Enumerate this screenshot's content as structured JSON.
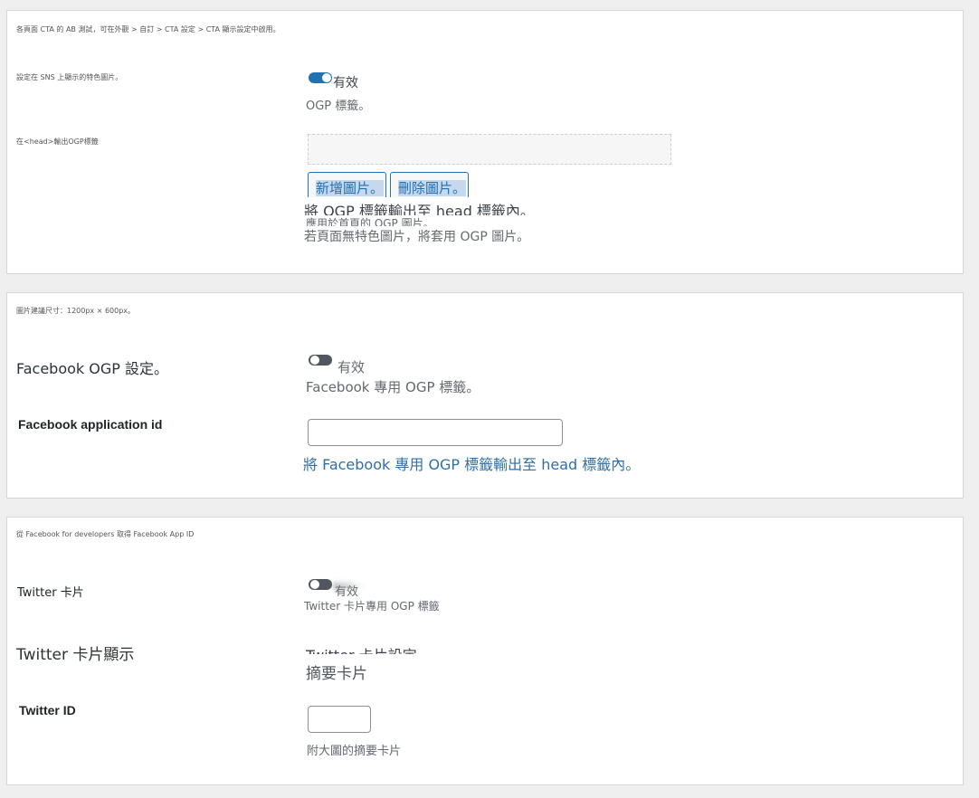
{
  "colors": {
    "accent": "#2271b1",
    "toggle_off": "#50575e",
    "link": "#2f6fa6",
    "page_bg": "#efefef"
  },
  "panel1": {
    "top_note": "各頁面 CTA 的 AB 測試，可在外觀 > 自訂 > CTA 設定 > CTA 顯示設定中啟用。",
    "sns_label": "設定在 SNS 上顯示的特色圖片。",
    "toggle_state": "on",
    "toggle_label": "有效",
    "ogp_desc": "OGP 標籤。",
    "head_label": "在<head>輸出OGP標籤",
    "add_image_button": "新增圖片。",
    "remove_image_button": "刪除圖片。",
    "overlap_line": "將 OGP 標籤輸出至 head 標籤內。",
    "clipped_line": "應用於首頁的 OGP 圖片。",
    "fallback_note": "若頁面無特色圖片，將套用 OGP 圖片。"
  },
  "panel2": {
    "size_note": "圖片建議尺寸：1200px × 600px。",
    "fb_label": "Facebook OGP 設定。",
    "toggle_state": "off",
    "toggle_label": "有效",
    "fb_desc": "Facebook 專用 OGP 標籤。",
    "app_id_label": "Facebook application id",
    "app_id_value": "",
    "fb_link": "將 Facebook 專用 OGP 標籤輸出至 head 標籤內。"
  },
  "panel3": {
    "dev_note": "從 Facebook for developers 取得 Facebook App ID",
    "twitter_label": "Twitter 卡片",
    "toggle_state": "off",
    "toggle_label": "有效",
    "twitter_desc": "Twitter 卡片專用 OGP 標籤",
    "display_label": "Twitter 卡片顯示",
    "settings_clipped": "Twitter 卡片設定",
    "summary_card": "摘要卡片",
    "twitter_id_label": "Twitter ID",
    "twitter_id_value": "",
    "large_image_note": "附大圖的摘要卡片"
  }
}
